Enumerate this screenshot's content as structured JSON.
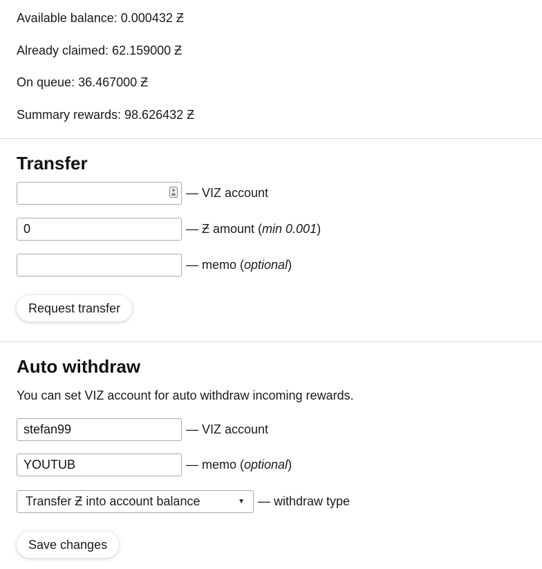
{
  "balance": {
    "available": "Available balance: 0.000432 Ƶ",
    "claimed": "Already claimed: 62.159000 Ƶ",
    "queue": "On queue: 36.467000 Ƶ",
    "summary": "Summary rewards: 98.626432 Ƶ"
  },
  "transfer": {
    "heading": "Transfer",
    "account_value": "",
    "account_label": "— VIZ account",
    "amount_value": "0",
    "amount_label_prefix": "— Ƶ amount (",
    "amount_label_em": "min 0.001",
    "amount_label_suffix": ")",
    "memo_value": "",
    "memo_label_prefix": "— memo (",
    "memo_label_em": "optional",
    "memo_label_suffix": ")",
    "button": "Request transfer"
  },
  "auto_withdraw": {
    "heading": "Auto withdraw",
    "description": "You can set VIZ account for auto withdraw incoming rewards.",
    "account_value": "stefan99",
    "account_label": "— VIZ account",
    "memo_value": "YOUTUB",
    "memo_label_prefix": "— memo (",
    "memo_label_em": "optional",
    "memo_label_suffix": ")",
    "type_selected": "Transfer Ƶ into account balance",
    "type_label": "— withdraw type",
    "button": "Save changes"
  },
  "icons": {
    "contact_card": "contact-card-icon",
    "select_arrow": "chevron-down-icon"
  },
  "colors": {
    "text": "#1a1a1a",
    "border": "#a9a9a9",
    "divider": "#dcdcdc"
  }
}
